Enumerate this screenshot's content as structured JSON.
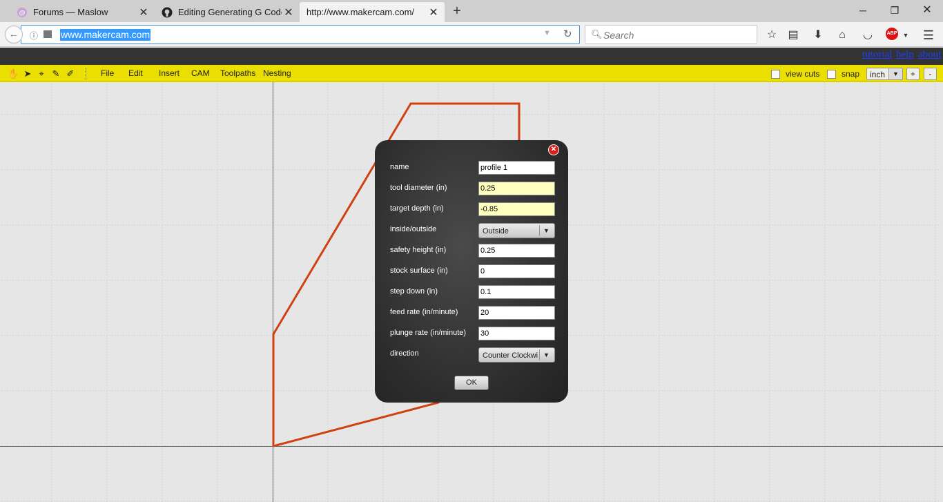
{
  "browser": {
    "tabs": [
      {
        "title": "Forums — Maslow",
        "icon": "maslow-forum-icon",
        "active": false
      },
      {
        "title": "Editing Generating G Code U",
        "icon": "github-icon",
        "active": false
      },
      {
        "title": "http://www.makercam.com/",
        "icon": "",
        "active": true
      }
    ],
    "new_tab": "+",
    "url": "www.makercam.com",
    "search_placeholder": "Search",
    "abp": "ABP"
  },
  "site_links": {
    "tutorial": "tutorial",
    "help": "help",
    "about": "about"
  },
  "toolbar": {
    "menus": [
      "File",
      "Edit",
      "Insert",
      "CAM",
      "Toolpaths",
      "Nesting"
    ],
    "view_cuts_label": "view cuts",
    "snap_label": "snap",
    "unit": "inch",
    "zoom_in": "+",
    "zoom_out": "-"
  },
  "dialog": {
    "fields": {
      "name": {
        "label": "name",
        "value": "profile 1"
      },
      "tool_diameter": {
        "label": "tool diameter (in)",
        "value": "0.25"
      },
      "target_depth": {
        "label": "target depth (in)",
        "value": "-0.85"
      },
      "inside_outside": {
        "label": "inside/outside",
        "value": "Outside"
      },
      "safety_height": {
        "label": "safety height (in)",
        "value": "0.25"
      },
      "stock_surface": {
        "label": "stock surface (in)",
        "value": "0"
      },
      "step_down": {
        "label": "step down (in)",
        "value": "0.1"
      },
      "feed_rate": {
        "label": "feed rate (in/minute)",
        "value": "20"
      },
      "plunge_rate": {
        "label": "plunge rate (in/minute)",
        "value": "30"
      },
      "direction": {
        "label": "direction",
        "value": "Counter Clockwise"
      }
    },
    "ok_label": "OK"
  },
  "colors": {
    "toolbar_yellow": "#eadf00",
    "shape_stroke": "#d04010",
    "highlight_field": "#ffffc0",
    "link_blue": "#1f3bff"
  }
}
